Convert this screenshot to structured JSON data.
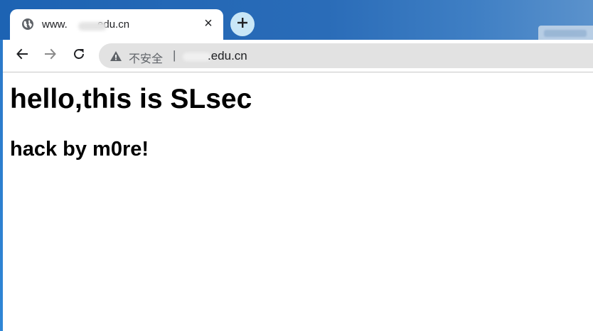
{
  "browser": {
    "tab": {
      "title": "www.",
      "title_suffix": ".edu.cn",
      "favicon": "globe-icon",
      "close_label": "×"
    },
    "new_tab": {
      "icon": "plus-icon"
    },
    "toolbar": {
      "back_icon": "arrow-left-icon",
      "forward_icon": "arrow-right-icon",
      "reload_icon": "reload-icon"
    },
    "omnibox": {
      "security_icon": "warning-icon",
      "security_text": "不安全",
      "separator": "|",
      "url_suffix": ".edu.cn"
    }
  },
  "page": {
    "heading": "hello,this is SLsec",
    "subheading": "hack by m0re!"
  },
  "colors": {
    "titlebar": "#1d63b3",
    "new_tab_bg": "#c9e7f7",
    "omnibox_bg": "#e2e2e2"
  }
}
